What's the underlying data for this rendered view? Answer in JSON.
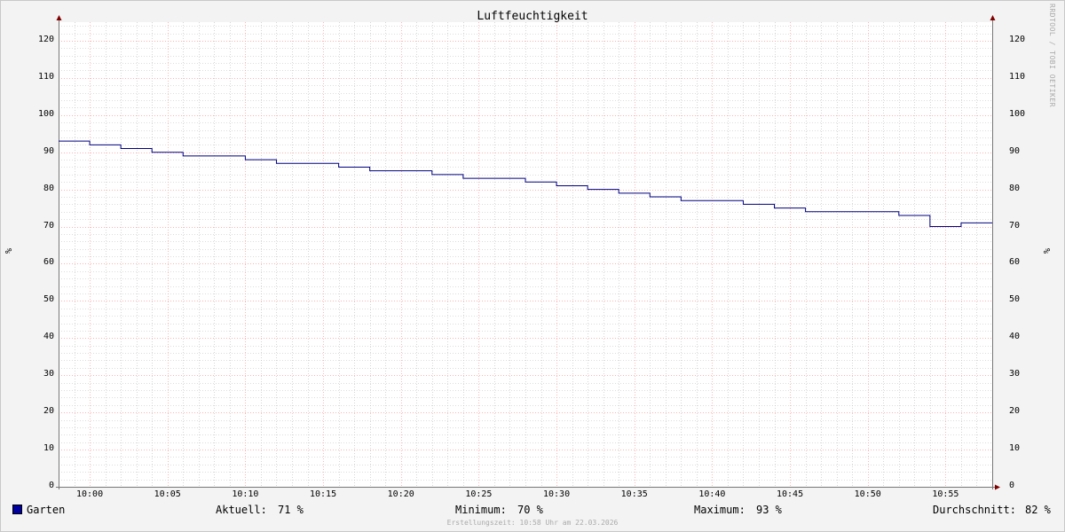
{
  "chart_data": {
    "type": "line",
    "title": "Luftfeuchtigkeit",
    "ylabel": "%",
    "ylim": [
      0,
      125
    ],
    "yticks": [
      0,
      10,
      20,
      30,
      40,
      50,
      60,
      70,
      80,
      90,
      100,
      110,
      120
    ],
    "xlim": [
      "09:58",
      "10:58"
    ],
    "xticks": [
      "10:00",
      "10:05",
      "10:10",
      "10:15",
      "10:20",
      "10:25",
      "10:30",
      "10:35",
      "10:40",
      "10:45",
      "10:50",
      "10:55"
    ],
    "grid": true,
    "step": true,
    "series": [
      {
        "name": "Garten",
        "color": "#000080",
        "points": [
          [
            "09:58",
            93
          ],
          [
            "10:00",
            92
          ],
          [
            "10:02",
            91
          ],
          [
            "10:04",
            90
          ],
          [
            "10:06",
            89
          ],
          [
            "10:08",
            89
          ],
          [
            "10:10",
            88
          ],
          [
            "10:12",
            87
          ],
          [
            "10:14",
            87
          ],
          [
            "10:16",
            86
          ],
          [
            "10:18",
            85
          ],
          [
            "10:20",
            85
          ],
          [
            "10:22",
            84
          ],
          [
            "10:24",
            83
          ],
          [
            "10:26",
            83
          ],
          [
            "10:28",
            82
          ],
          [
            "10:30",
            81
          ],
          [
            "10:32",
            80
          ],
          [
            "10:34",
            79
          ],
          [
            "10:36",
            78
          ],
          [
            "10:38",
            77
          ],
          [
            "10:40",
            77
          ],
          [
            "10:42",
            76
          ],
          [
            "10:44",
            75
          ],
          [
            "10:46",
            74
          ],
          [
            "10:48",
            74
          ],
          [
            "10:50",
            74
          ],
          [
            "10:52",
            73
          ],
          [
            "10:54",
            70
          ],
          [
            "10:56",
            71
          ],
          [
            "10:58",
            71
          ]
        ]
      }
    ],
    "legend_position": "bottom-left"
  },
  "legend": {
    "series_name": "Garten",
    "aktuell_label": "Aktuell:",
    "aktuell_value": "71 %",
    "minimum_label": "Minimum:",
    "minimum_value": "70 %",
    "maximum_label": "Maximum:",
    "maximum_value": "93 %",
    "durchschnitt_label": "Durchschnitt:",
    "durchschnitt_value": "82 %"
  },
  "watermark": "RRDTOOL / TOBI OETIKER",
  "footer": "Erstellungszeit: 10:58 Uhr am 22.03.2026",
  "colors": {
    "background": "#f3f3f3",
    "plot_background": "#ffffff",
    "major_grid": "#ff9999",
    "minor_grid": "#bbbbbb",
    "axis_arrow": "#800000",
    "line": "#000080"
  }
}
